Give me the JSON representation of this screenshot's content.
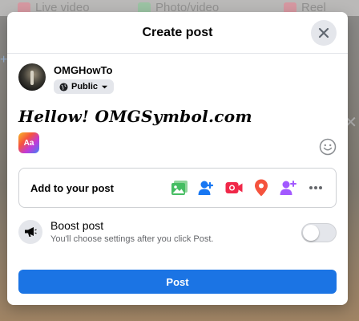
{
  "background": {
    "tabs": [
      {
        "label": "Live video",
        "icon": "live-video-icon",
        "color": "#f02849"
      },
      {
        "label": "Photo/video",
        "icon": "photo-icon",
        "color": "#45bd62"
      },
      {
        "label": "Reel",
        "icon": "reel-icon",
        "color": "#f02849"
      }
    ]
  },
  "modal": {
    "title": "Create post",
    "close_icon": "close-icon"
  },
  "author": {
    "name": "OMGHowTo",
    "privacy_label": "Public",
    "privacy_icon": "globe-icon"
  },
  "composer": {
    "text": "Hellow! OMGSymbol.com",
    "bg_picker_label": "Aa",
    "emoji_icon": "smiley-icon"
  },
  "add_to_post": {
    "label": "Add to your post",
    "icons": [
      {
        "name": "photo-video-icon",
        "color": "#45bd62"
      },
      {
        "name": "tag-people-icon",
        "color": "#1877f2"
      },
      {
        "name": "live-video-icon",
        "color": "#f02849"
      },
      {
        "name": "check-in-icon",
        "color": "#f5533d"
      },
      {
        "name": "add-friend-icon",
        "color": "#a259ff"
      },
      {
        "name": "more-icon",
        "color": "#65676b"
      }
    ]
  },
  "boost": {
    "title": "Boost post",
    "description": "You'll choose settings after you click Post.",
    "toggle_on": false
  },
  "actions": {
    "post_label": "Post"
  },
  "colors": {
    "accent": "#1b74e4",
    "secondary_text": "#65676b"
  }
}
